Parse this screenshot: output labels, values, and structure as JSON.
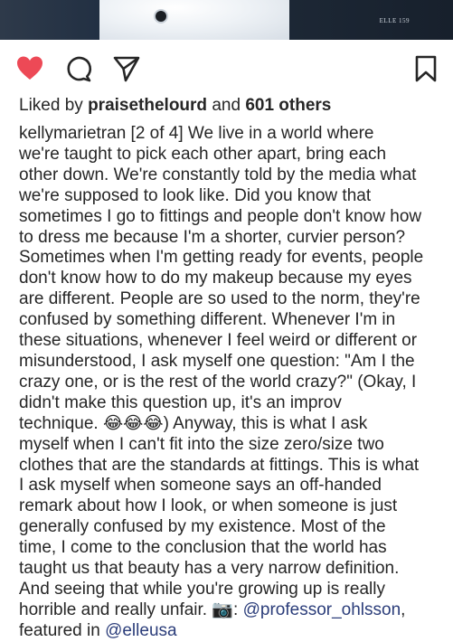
{
  "photo": {
    "magazine_label": "ELLE 159"
  },
  "actions": {
    "icons": [
      "heart-icon",
      "comment-icon",
      "share-icon",
      "bookmark-icon"
    ],
    "like_color": "#ed4956"
  },
  "likes": {
    "prefix": "Liked by",
    "user": "praisethelourd",
    "middle": "and",
    "count": "601 others"
  },
  "caption": {
    "username": "kellymarietran",
    "lines": [
      "[2 of 4] We live in a world where",
      "we're taught to pick each other apart, bring each",
      "other down. We're constantly told by the media what",
      "we're supposed to look like. Did you know that",
      "sometimes I go to fittings and people don't know how",
      "to dress me because I'm a shorter, curvier person?",
      "Sometimes when I'm getting ready for events, people",
      "don't know how to do my makeup because my eyes",
      "are different. People are so used to the norm, they're",
      "confused by something different. Whenever I'm in",
      "these situations, whenever I feel weird or different or",
      "misunderstood, I ask myself one question: \"Am I the",
      "crazy one, or is the rest of the world crazy?\" (Okay, I",
      "didn't make this question up, it's an improv",
      "technique.",
      "myself when I can't fit into the size zero/size two",
      "clothes that are the standards at fittings. This is what",
      "I ask myself when someone says an off-handed",
      "remark about how I look, or when someone is just",
      "generally confused by my existence. Most of the",
      "time, I come to the conclusion that the world has",
      "taught us that beauty has a very narrow definition.",
      "And seeing that while you're growing up is really",
      "horrible and really unfair."
    ],
    "emoji_line_after": "😂😂😂",
    "emoji_line_rest": ") Anyway, this is what I ask",
    "camera_emoji": "📷",
    "camera_suffix": ":",
    "photographer": "@professor_ohlsson",
    "featured_prefix": "featured in",
    "featured_handle": "@elleusa"
  },
  "colors": {
    "text": "#262626",
    "mention": "#2b3d7a",
    "heart": "#ed4956"
  }
}
